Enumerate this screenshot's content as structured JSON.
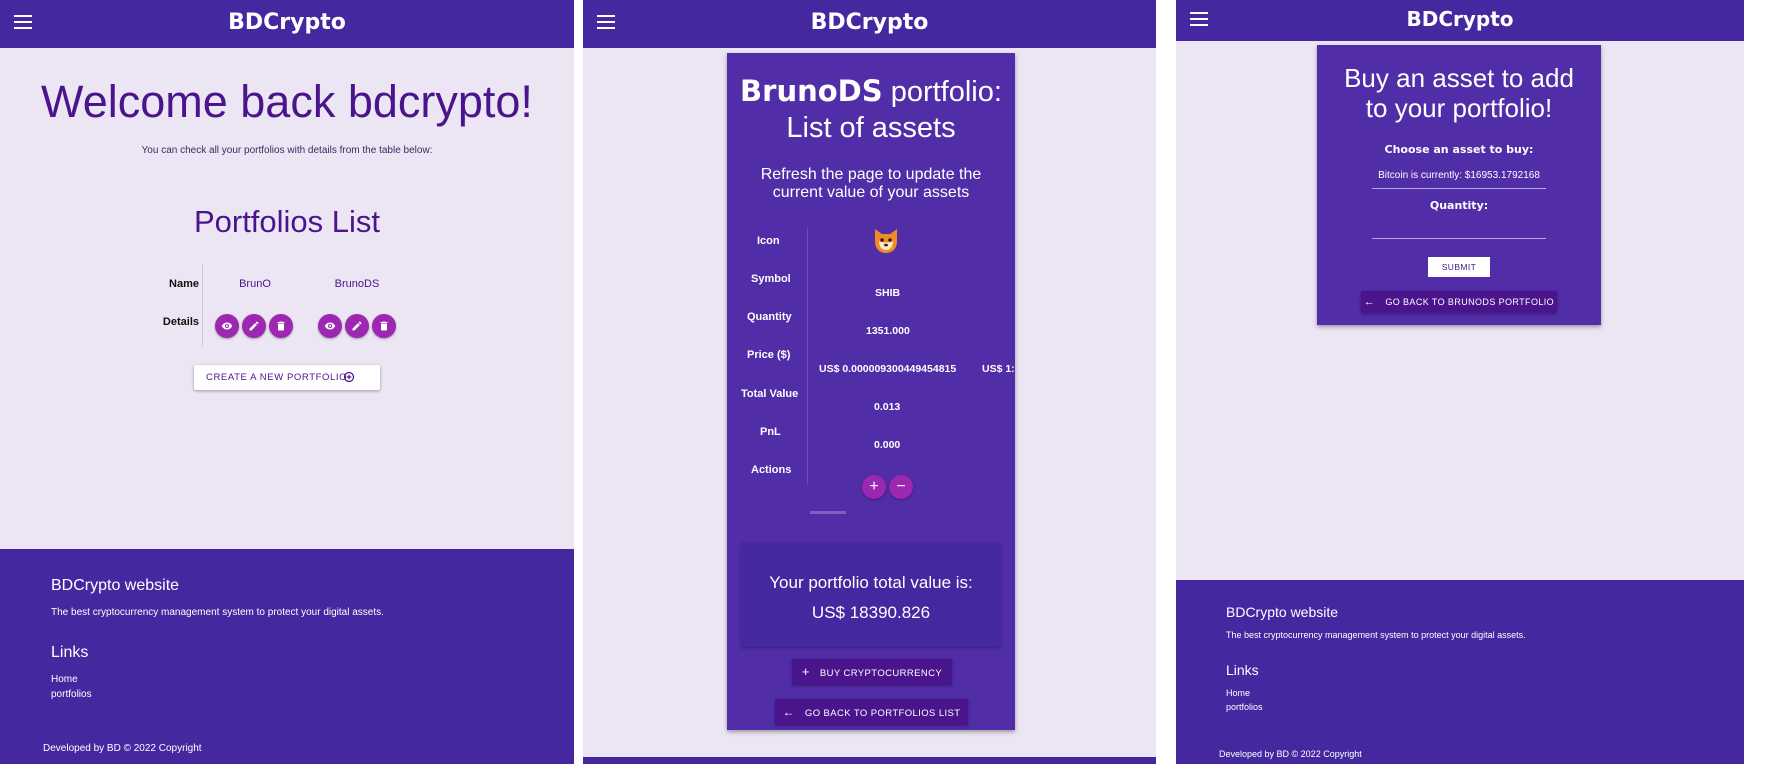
{
  "app": {
    "title": "BDCrypto"
  },
  "home": {
    "welcome": "Welcome back bdcrypto!",
    "subtitle": "You can check all your portfolios with details from the table below:",
    "list_title": "Portfolios List",
    "table": {
      "name_label": "Name",
      "details_label": "Details",
      "portfolios": [
        "BrunO",
        "BrunoDS"
      ]
    },
    "create_button": "CREATE A NEW PORTFOLIO"
  },
  "portfolio": {
    "name": "BrunoDS",
    "title_rest": "portfolio:",
    "title_line2": "List of assets",
    "refresh_note": "Refresh the page to update the current value of your assets",
    "labels": [
      "Icon",
      "Symbol",
      "Quantity",
      "Price ($)",
      "Total Value",
      "PnL",
      "Actions"
    ],
    "asset": {
      "symbol": "SHIB",
      "quantity": "1351.000",
      "price": "US$ 0.000009300449454815",
      "price_cutoff": "US$ 1:",
      "total_value": "0.013",
      "pnl": "0.000",
      "add_icon": "+",
      "remove_icon": "−"
    },
    "total_label": "Your portfolio total value is:",
    "total_value": "US$ 18390.826",
    "buy_button": "BUY CRYPTOCURRENCY",
    "back_list_button": "GO BACK TO PORTFOLIOS LIST"
  },
  "buy": {
    "title": "Buy an asset to add to your portfolio!",
    "choose_label": "Choose an asset to buy:",
    "select_value": "Bitcoin is currently: $16953.1792168",
    "quantity_label": "Quantity:",
    "quantity_value": "",
    "submit": "SUBMIT",
    "back_button": "GO BACK TO BRUNODS PORTFOLIO"
  },
  "footer": {
    "heading": "BDCrypto website",
    "tagline": "The best cryptocurrency management system to protect your digital assets.",
    "links_heading": "Links",
    "links": [
      "Home",
      "portfolios"
    ],
    "copyright": "Developed by BD © 2022 Copyright"
  },
  "colors": {
    "appbar": "#4527a0",
    "background": "#ece6f4",
    "card": "#512da8",
    "accent": "#9c27b0",
    "dark_button": "#4a148c"
  }
}
